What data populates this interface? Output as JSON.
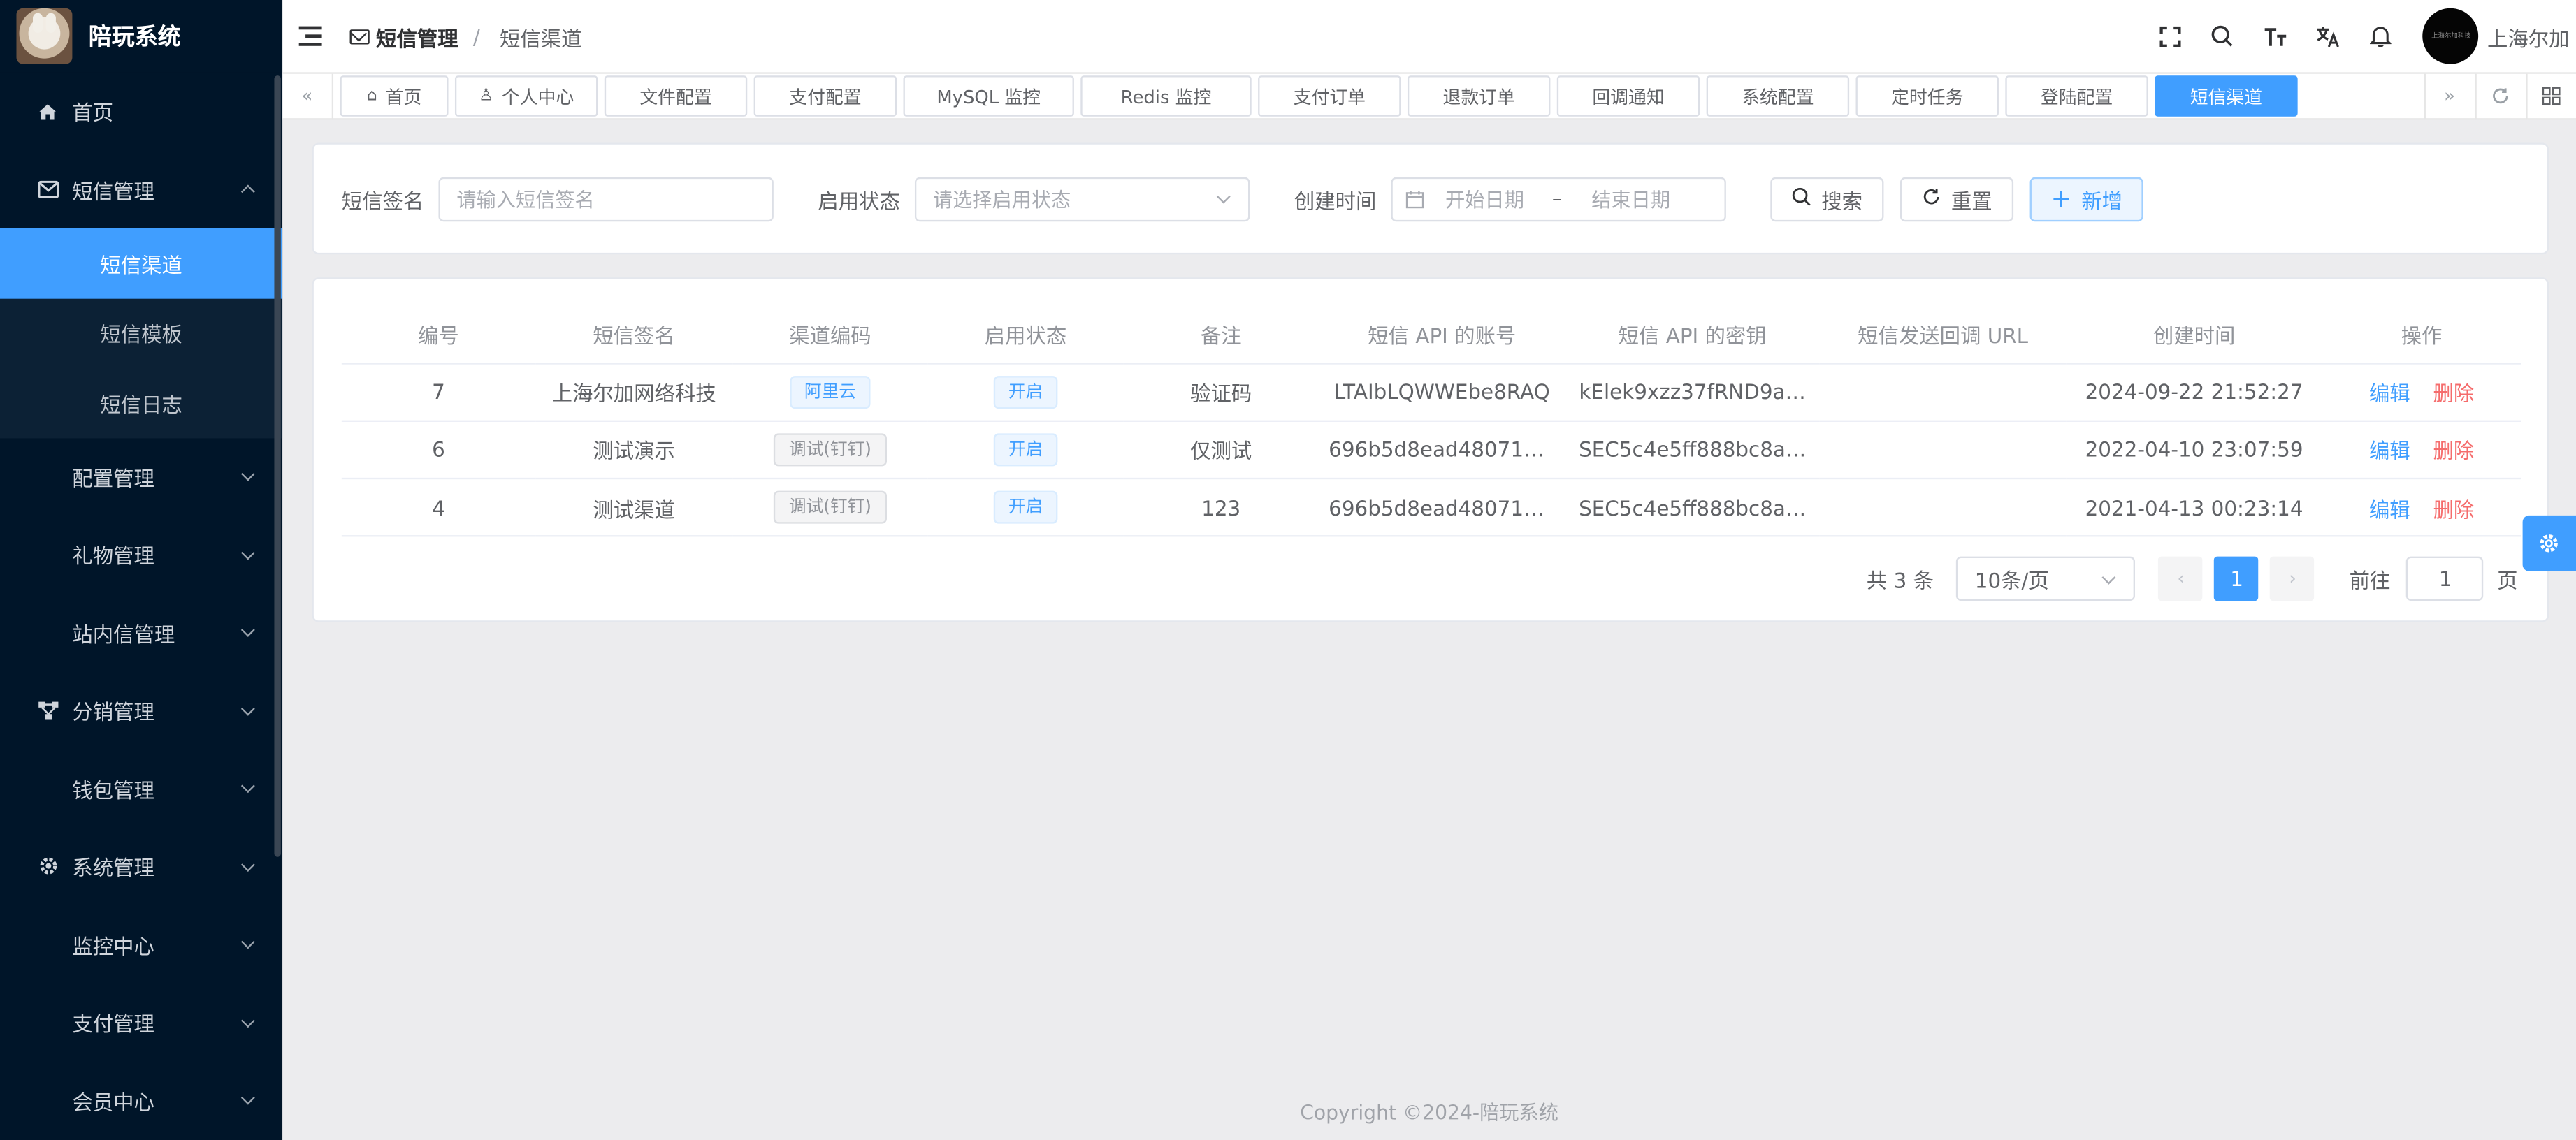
{
  "app": {
    "title": "陪玩系统"
  },
  "sidebar": {
    "items": [
      {
        "label": "首页",
        "icon": "home-icon"
      },
      {
        "label": "短信管理",
        "icon": "mail-icon",
        "expanded": true,
        "children": [
          {
            "label": "短信渠道",
            "active": true
          },
          {
            "label": "短信模板"
          },
          {
            "label": "短信日志"
          }
        ]
      },
      {
        "label": "配置管理"
      },
      {
        "label": "礼物管理"
      },
      {
        "label": "站内信管理"
      },
      {
        "label": "分销管理",
        "icon": "network-icon"
      },
      {
        "label": "钱包管理"
      },
      {
        "label": "系统管理",
        "icon": "gear-icon"
      },
      {
        "label": "监控中心"
      },
      {
        "label": "支付管理"
      },
      {
        "label": "会员中心"
      }
    ]
  },
  "header": {
    "breadcrumb": [
      "短信管理",
      "短信渠道"
    ],
    "user": "上海尔加",
    "avatar_text": "上海尔加科技"
  },
  "tags": [
    {
      "label": "首页",
      "icon": "home-icon"
    },
    {
      "label": "个人中心",
      "icon": "user-icon"
    },
    {
      "label": "文件配置"
    },
    {
      "label": "支付配置"
    },
    {
      "label": "MySQL 监控"
    },
    {
      "label": "Redis 监控"
    },
    {
      "label": "支付订单"
    },
    {
      "label": "退款订单"
    },
    {
      "label": "回调通知"
    },
    {
      "label": "系统配置"
    },
    {
      "label": "定时任务"
    },
    {
      "label": "登陆配置"
    },
    {
      "label": "短信渠道",
      "active": true
    }
  ],
  "search": {
    "signature_label": "短信签名",
    "signature_placeholder": "请输入短信签名",
    "status_label": "启用状态",
    "status_placeholder": "请选择启用状态",
    "time_label": "创建时间",
    "start_placeholder": "开始日期",
    "range_sep": "–",
    "end_placeholder": "结束日期",
    "search_btn": "搜索",
    "reset_btn": "重置",
    "add_btn": "新增"
  },
  "table": {
    "columns": [
      "编号",
      "短信签名",
      "渠道编码",
      "启用状态",
      "备注",
      "短信 API 的账号",
      "短信 API 的密钥",
      "短信发送回调 URL",
      "创建时间",
      "操作"
    ],
    "rows": [
      {
        "id": "7",
        "signature": "上海尔加网络科技",
        "channel": "阿里云",
        "channel_type": "primary",
        "status": "开启",
        "remark": "验证码",
        "api_key": "LTAIbLQWWEbe8RAQ",
        "api_secret": "kElek9xzz37fRND9a…",
        "callback": "",
        "created": "2024-09-22 21:52:27"
      },
      {
        "id": "6",
        "signature": "测试演示",
        "channel": "调试(钉钉)",
        "channel_type": "info",
        "status": "开启",
        "remark": "仅测试",
        "api_key": "696b5d8ead4807123…",
        "api_secret": "SEC5c4e5ff888bc8a…",
        "callback": "",
        "created": "2022-04-10 23:07:59"
      },
      {
        "id": "4",
        "signature": "测试渠道",
        "channel": "调试(钉钉)",
        "channel_type": "info",
        "status": "开启",
        "remark": "123",
        "api_key": "696b5d8ead4807123…",
        "api_secret": "SEC5c4e5ff888bc8a…",
        "callback": "",
        "created": "2021-04-13 00:23:14"
      }
    ],
    "op_edit": "编辑",
    "op_delete": "删除"
  },
  "pagination": {
    "total": "共 3 条",
    "page_size": "10条/页",
    "current": "1",
    "goto_label": "前往",
    "goto_value": "1",
    "page_unit": "页"
  },
  "footer": "Copyright ©2024-陪玩系统",
  "colors": {
    "primary": "#409eff",
    "sidebar": "#001529",
    "danger": "#f56c6c"
  }
}
